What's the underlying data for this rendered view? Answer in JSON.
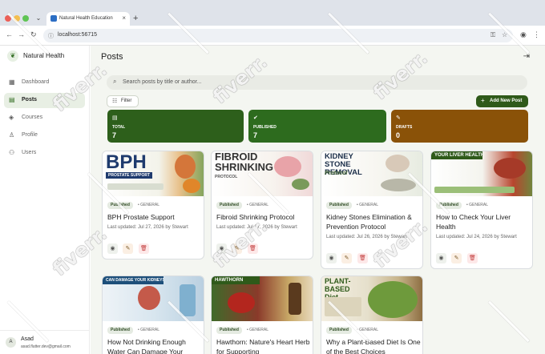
{
  "browser": {
    "tab_title": "Natural Health Education",
    "tab_close": "×",
    "new_tab": "+",
    "url": "localhost:56715",
    "icons": [
      "back-icon",
      "forward-icon",
      "reload-icon",
      "key-icon",
      "star-icon",
      "profile-icon",
      "menu-icon"
    ]
  },
  "sidebar": {
    "brand": "Natural Health",
    "items": [
      {
        "label": "Dashboard",
        "icon": "dashboard-icon",
        "active": false
      },
      {
        "label": "Posts",
        "icon": "posts-icon",
        "active": true
      },
      {
        "label": "Courses",
        "icon": "courses-icon",
        "active": false
      },
      {
        "label": "Profile",
        "icon": "profile-icon",
        "active": false
      },
      {
        "label": "Users",
        "icon": "users-icon",
        "active": false
      }
    ],
    "user": {
      "initial": "A",
      "name": "Asad",
      "email": "asad.flutter.dev@gmail.com"
    }
  },
  "main": {
    "title": "Posts",
    "search_placeholder": "Search posts by title or author...",
    "filter_label": "Filter",
    "add_label": "Add New Post",
    "stats": [
      {
        "label": "TOTAL",
        "value": "7",
        "color": "#2d5f1b"
      },
      {
        "label": "PUBLISHED",
        "value": "7",
        "color": "#2d6b1e"
      },
      {
        "label": "DRAFTS",
        "value": "0",
        "color": "#8a5208"
      }
    ],
    "posts": [
      {
        "status": "Published",
        "category": "GENERAL",
        "title": "BPH Prostate Support",
        "updated": "Last updated: Jul 27, 2026 by Stewart",
        "image_text": "BPH",
        "image_sub": "PROSTATE SUPPORT"
      },
      {
        "status": "Published",
        "category": "GENERAL",
        "title": "Fibroid Shrinking Protocol",
        "updated": "Last updated: Jul 27, 2026 by Stewart",
        "image_text": "FIBROID SHRINKING",
        "image_sub": "PROTOCOL"
      },
      {
        "status": "Published",
        "category": "GENERAL",
        "title": "Kidney Stones Elimination & Prevention Protocol",
        "updated": "Last updated: Jul 26, 2026 by Stewart",
        "image_text": "KIDNEY STONE REMOVAL",
        "image_sub": "Protocol"
      },
      {
        "status": "Published",
        "category": "GENERAL",
        "title": "How to Check Your Liver Health",
        "updated": "Last updated: Jul 24, 2026 by Stewart",
        "image_text": "YOUR LIVER HEALTH",
        "image_sub": ""
      },
      {
        "status": "Published",
        "category": "GENERAL",
        "title": "How Not Drinking Enough Water Can Damage Your",
        "updated": "",
        "image_text": "CAN DAMAGE YOUR KIDNEYS",
        "image_sub": ""
      },
      {
        "status": "Published",
        "category": "GENERAL",
        "title": "Hawthorn: Nature's Heart Herb for Supporting",
        "updated": "",
        "image_text": "HAWTHORN",
        "image_sub": ""
      },
      {
        "status": "Published",
        "category": "GENERAL",
        "title": "Why a Plant-Based Diet Is One of the Best Choices",
        "updated": "",
        "image_text": "PLANT-BASED Diet",
        "image_sub": ""
      }
    ]
  },
  "watermark": "fiverr."
}
